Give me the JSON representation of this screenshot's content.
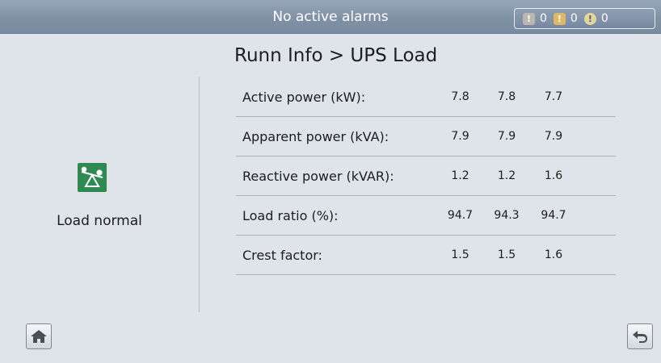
{
  "header": {
    "alarm_text": "No active alarms",
    "alarm_counts": [
      {
        "icon": "minor-alarm-icon",
        "count": "0"
      },
      {
        "icon": "major-alarm-icon",
        "count": "0"
      },
      {
        "icon": "critical-alarm-icon",
        "count": "0"
      }
    ]
  },
  "page": {
    "title": "Runn Info > UPS Load"
  },
  "status": {
    "icon": "load-balance-icon",
    "label": "Load normal",
    "color": "#2f8a52"
  },
  "table": {
    "rows": [
      {
        "label": "Active power (kW):",
        "values": [
          "7.8",
          "7.8",
          "7.7"
        ]
      },
      {
        "label": "Apparent power (kVA):",
        "values": [
          "7.9",
          "7.9",
          "7.9"
        ]
      },
      {
        "label": "Reactive power (kVAR):",
        "values": [
          "1.2",
          "1.2",
          "1.6"
        ]
      },
      {
        "label": "Load ratio (%):",
        "values": [
          "94.7",
          "94.3",
          "94.7"
        ]
      },
      {
        "label": "Crest factor:",
        "values": [
          "1.5",
          "1.5",
          "1.6"
        ]
      }
    ]
  },
  "footer": {
    "home_icon": "home-icon",
    "back_icon": "back-arrow-icon"
  }
}
